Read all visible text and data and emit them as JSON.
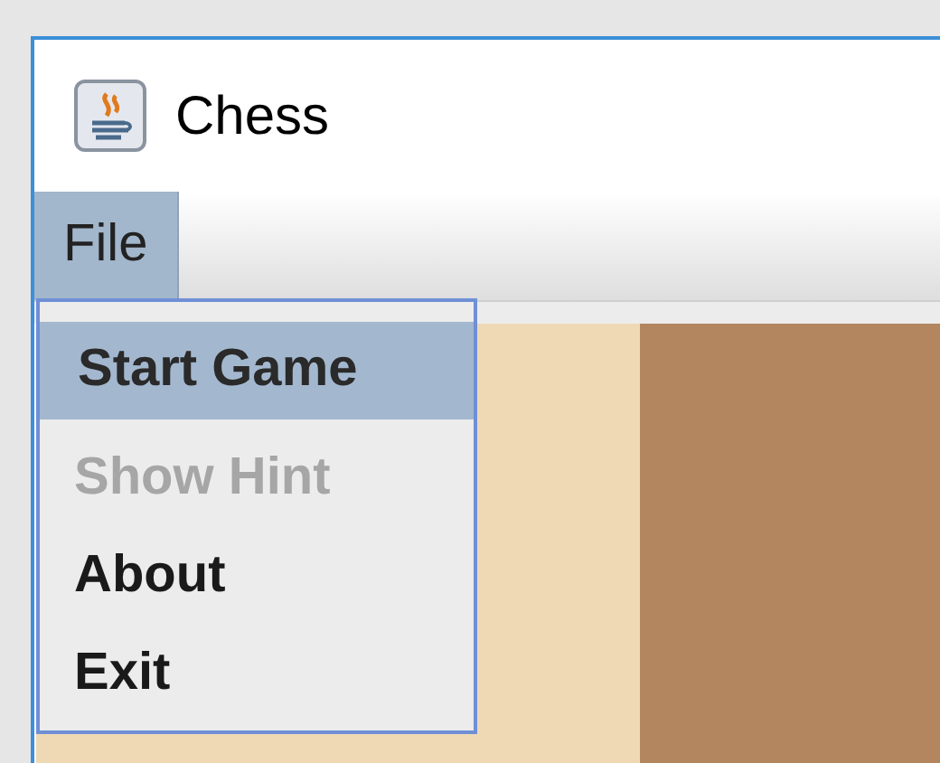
{
  "window": {
    "title": "Chess"
  },
  "menu_bar": [
    {
      "label": "File",
      "selected": true
    }
  ],
  "menu": {
    "items": [
      {
        "label": "Start Game",
        "selected": true,
        "disabled": false
      },
      {
        "label": "Show Hint",
        "selected": false,
        "disabled": true
      },
      {
        "label": "About",
        "selected": false,
        "disabled": false
      },
      {
        "label": "Exit",
        "selected": false,
        "disabled": false
      }
    ]
  },
  "board": {
    "squares": [
      {
        "kind": "light"
      },
      {
        "kind": "dark"
      }
    ]
  }
}
